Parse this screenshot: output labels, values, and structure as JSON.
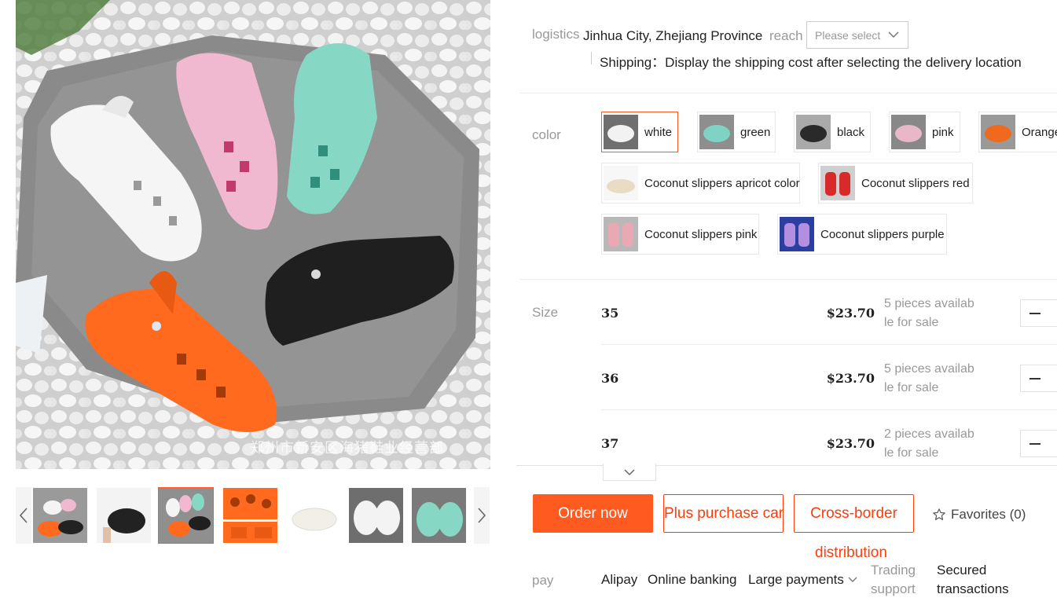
{
  "logistics": {
    "label": "logistics",
    "origin": "Jinhua City, Zhejiang Province",
    "reach_label": "reach",
    "select_placeholder": "Please select",
    "shipping_note": "Shipping：Display the shipping cost after selecting the delivery location"
  },
  "color": {
    "label": "color",
    "options": [
      {
        "label": "white",
        "swatch": "#f2f2f2",
        "selected": true
      },
      {
        "label": "green",
        "swatch": "#7fd3c4"
      },
      {
        "label": "black",
        "swatch": "#2a2a2a"
      },
      {
        "label": "pink",
        "swatch": "#e8b8c8"
      },
      {
        "label": "Orange",
        "swatch": "#f06a1e"
      },
      {
        "label": "Coconut slippers apricot color",
        "swatch": "#e9dcc4"
      },
      {
        "label": "Coconut slippers red",
        "swatch": "#d82a2a"
      },
      {
        "label": "Coconut slippers pink",
        "swatch": "#eaa8b4"
      },
      {
        "label": "Coconut slippers purple",
        "swatch": "#b48fe0"
      }
    ]
  },
  "size": {
    "label": "Size",
    "rows": [
      {
        "size": "35",
        "price": "$23.70",
        "stock_line1": "5 pieces availab",
        "stock_line2": "le for sale"
      },
      {
        "size": "36",
        "price": "$23.70",
        "stock_line1": "5 pieces availab",
        "stock_line2": "le for sale"
      },
      {
        "size": "37",
        "price": "$23.70",
        "stock_line1": "2 pieces availab",
        "stock_line2": "le for sale"
      }
    ]
  },
  "actions": {
    "order_now": "Order now",
    "add_to_cart": "Plus purchase car",
    "cross_border_line1": "Cross-border",
    "cross_border_line2": "distribution",
    "favorites": "Favorites (0)"
  },
  "pay": {
    "label": "pay",
    "methods": [
      "Alipay",
      "Online banking",
      "Large payments"
    ],
    "trading_support_line1": "Trading",
    "trading_support_line2": "support",
    "secured_line1": "Secured",
    "secured_line2": "transactions"
  },
  "gallery": {
    "watermark": "郑州市新安区海猪鞋业经营部",
    "thumbnails": [
      "mixed-colors",
      "black",
      "mixed-colors-active",
      "orange",
      "white-side",
      "white-pair",
      "green-pair"
    ],
    "active_thumbnail": 2
  },
  "colors": {
    "accent": "#ff5a1f",
    "accent_text": "#ff3c0a",
    "muted_text": "#999999"
  }
}
